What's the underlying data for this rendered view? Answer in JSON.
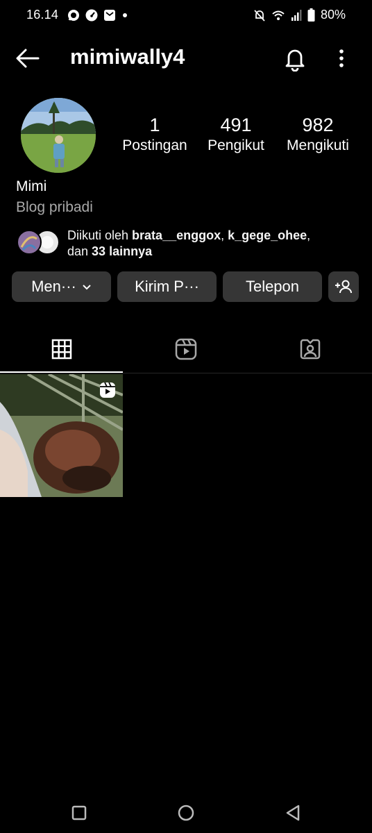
{
  "status_bar": {
    "time": "16.14",
    "battery": "80%",
    "left_icons": [
      "whatsapp-icon",
      "gauge-icon",
      "message-icon",
      "dot-icon"
    ],
    "right_icons": [
      "bell-off-icon",
      "wifi-icon",
      "signal-icon",
      "battery-icon"
    ]
  },
  "header": {
    "username": "mimiwally4"
  },
  "profile": {
    "stats": [
      {
        "value": "1",
        "label": "Postingan"
      },
      {
        "value": "491",
        "label": "Pengikut"
      },
      {
        "value": "982",
        "label": "Mengikuti"
      }
    ],
    "name": "Mimi",
    "category": "Blog pribadi",
    "followed_by": {
      "prefix": "Diikuti oleh ",
      "user1": "brata__enggox",
      "sep": ", ",
      "user2": "k_gege_ohee",
      "suffix_line": ",",
      "line2_prefix": "dan ",
      "others": "33 lainnya"
    }
  },
  "buttons": {
    "following": "Men···",
    "message": "Kirim P···",
    "call": "Telepon"
  },
  "tabs": [
    {
      "name": "grid",
      "icon": "grid-icon",
      "active": true
    },
    {
      "name": "reels",
      "icon": "reels-icon",
      "active": false
    },
    {
      "name": "tagged",
      "icon": "tagged-icon",
      "active": false
    }
  ],
  "posts": [
    {
      "type": "reel",
      "icon": "reels-badge-icon"
    }
  ],
  "colors": {
    "background": "#000000",
    "button_bg": "#363636",
    "secondary_text": "#a8a8a8"
  }
}
